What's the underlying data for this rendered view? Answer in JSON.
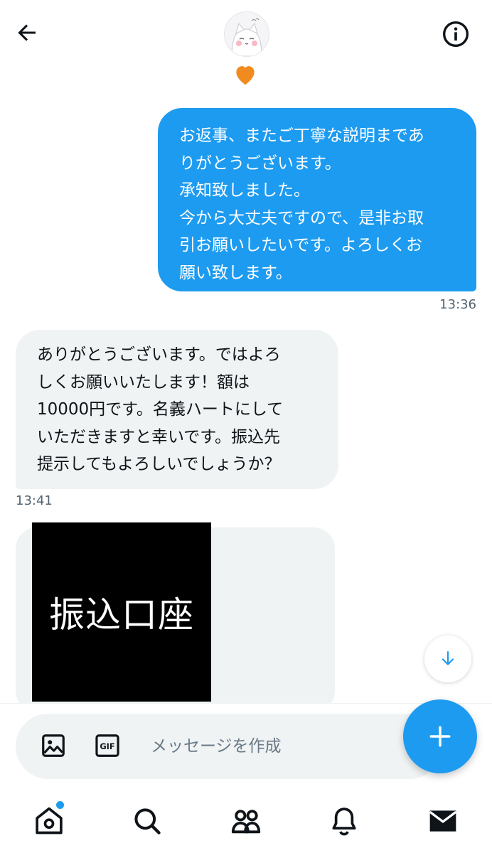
{
  "header": {
    "back_icon": "arrow-left-icon",
    "info_icon": "info-circle-icon",
    "heart_emoji": "🧡"
  },
  "messages": [
    {
      "direction": "outgoing",
      "text": "お返事、またご丁寧な説明まであ\nりがとうございます。\n承知致しました。\n今から大丈夫ですので、是非お取\n引お願いしたいです。よろしくお\n願い致します。",
      "time": "13:36"
    },
    {
      "direction": "incoming",
      "text": "ありがとうございます。ではよろ\nしくお願いいたします！額は\n10000円です。名義ハートにして\nいただきますと幸いです。振込先\n提示してもよろしいでしょうか？",
      "time": "13:41"
    },
    {
      "direction": "incoming",
      "image_text": "振込口座"
    }
  ],
  "composer": {
    "placeholder": "メッセージを作成",
    "gif_label": "GIF"
  },
  "nav": [
    "home-icon",
    "search-icon",
    "communities-icon",
    "bell-icon",
    "mail-icon"
  ],
  "colors": {
    "accent": "#1d9bf0",
    "incoming_bubble": "#eff3f4",
    "time_text": "#536471"
  }
}
